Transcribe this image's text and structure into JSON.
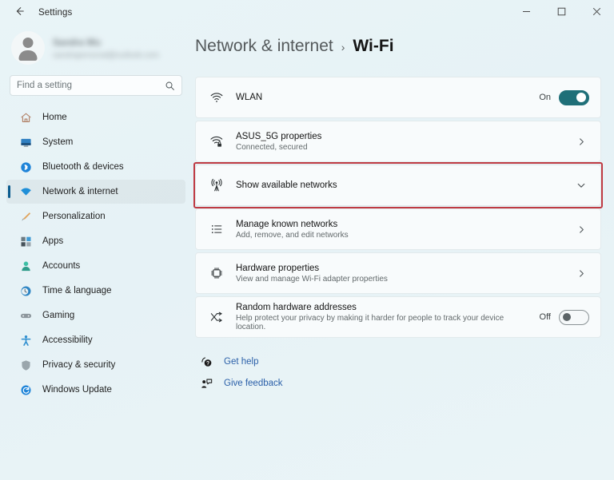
{
  "window": {
    "title": "Settings",
    "back_icon": "back-arrow-icon",
    "controls": {
      "minimize": "–",
      "maximize": "□",
      "close": "✕"
    }
  },
  "sidebar": {
    "profile": {
      "name_redacted": "Sandra Wu",
      "email_redacted": "sandrapersonal@outlook.com"
    },
    "search": {
      "placeholder": "Find a setting",
      "value": "",
      "icon": "search-icon"
    },
    "items": [
      {
        "label": "Home",
        "icon": "home-icon",
        "selected": false
      },
      {
        "label": "System",
        "icon": "system-icon",
        "selected": false
      },
      {
        "label": "Bluetooth & devices",
        "icon": "bluetooth-icon",
        "selected": false
      },
      {
        "label": "Network & internet",
        "icon": "network-wifi-icon",
        "selected": true
      },
      {
        "label": "Personalization",
        "icon": "paintbrush-icon",
        "selected": false
      },
      {
        "label": "Apps",
        "icon": "apps-icon",
        "selected": false
      },
      {
        "label": "Accounts",
        "icon": "account-person-icon",
        "selected": false
      },
      {
        "label": "Time & language",
        "icon": "clock-globe-icon",
        "selected": false
      },
      {
        "label": "Gaming",
        "icon": "gamepad-icon",
        "selected": false
      },
      {
        "label": "Accessibility",
        "icon": "accessibility-person-icon",
        "selected": false
      },
      {
        "label": "Privacy & security",
        "icon": "shield-icon",
        "selected": false
      },
      {
        "label": "Windows Update",
        "icon": "update-refresh-icon",
        "selected": false
      }
    ]
  },
  "main": {
    "breadcrumb": {
      "parent": "Network & internet",
      "separator": "›",
      "current": "Wi-Fi"
    },
    "rows": [
      {
        "title": "WLAN",
        "subtitle": "",
        "icon": "wifi-icon",
        "control": "toggle",
        "state_label": "On",
        "state_on": true
      },
      {
        "title": "ASUS_5G properties",
        "subtitle": "Connected, secured",
        "icon": "wifi-lock-icon",
        "control": "chevron-right",
        "state_label": "",
        "state_on": false
      },
      {
        "title": "Show available networks",
        "subtitle": "",
        "icon": "broadcast-tower-icon",
        "control": "chevron-down",
        "state_label": "",
        "state_on": false,
        "highlighted": true
      },
      {
        "title": "Manage known networks",
        "subtitle": "Add, remove, and edit networks",
        "icon": "list-icon",
        "control": "chevron-right",
        "state_label": "",
        "state_on": false
      },
      {
        "title": "Hardware properties",
        "subtitle": "View and manage Wi-Fi adapter properties",
        "icon": "chip-icon",
        "control": "chevron-right",
        "state_label": "",
        "state_on": false
      },
      {
        "title": "Random hardware addresses",
        "subtitle": "Help protect your privacy by making it harder for people to track your device location.",
        "icon": "shuffle-icon",
        "control": "toggle",
        "state_label": "Off",
        "state_on": false
      }
    ],
    "links": [
      {
        "label": "Get help",
        "icon": "help-icon"
      },
      {
        "label": "Give feedback",
        "icon": "feedback-icon"
      }
    ]
  },
  "colors": {
    "page_background": "#e7f3f6",
    "card_background": "#f8fbfc",
    "accent_selection": "#0a5c8f",
    "toggle_on": "#1f6f78",
    "annotation_red": "#bf3a43",
    "link_blue": "#2a5fa8"
  }
}
